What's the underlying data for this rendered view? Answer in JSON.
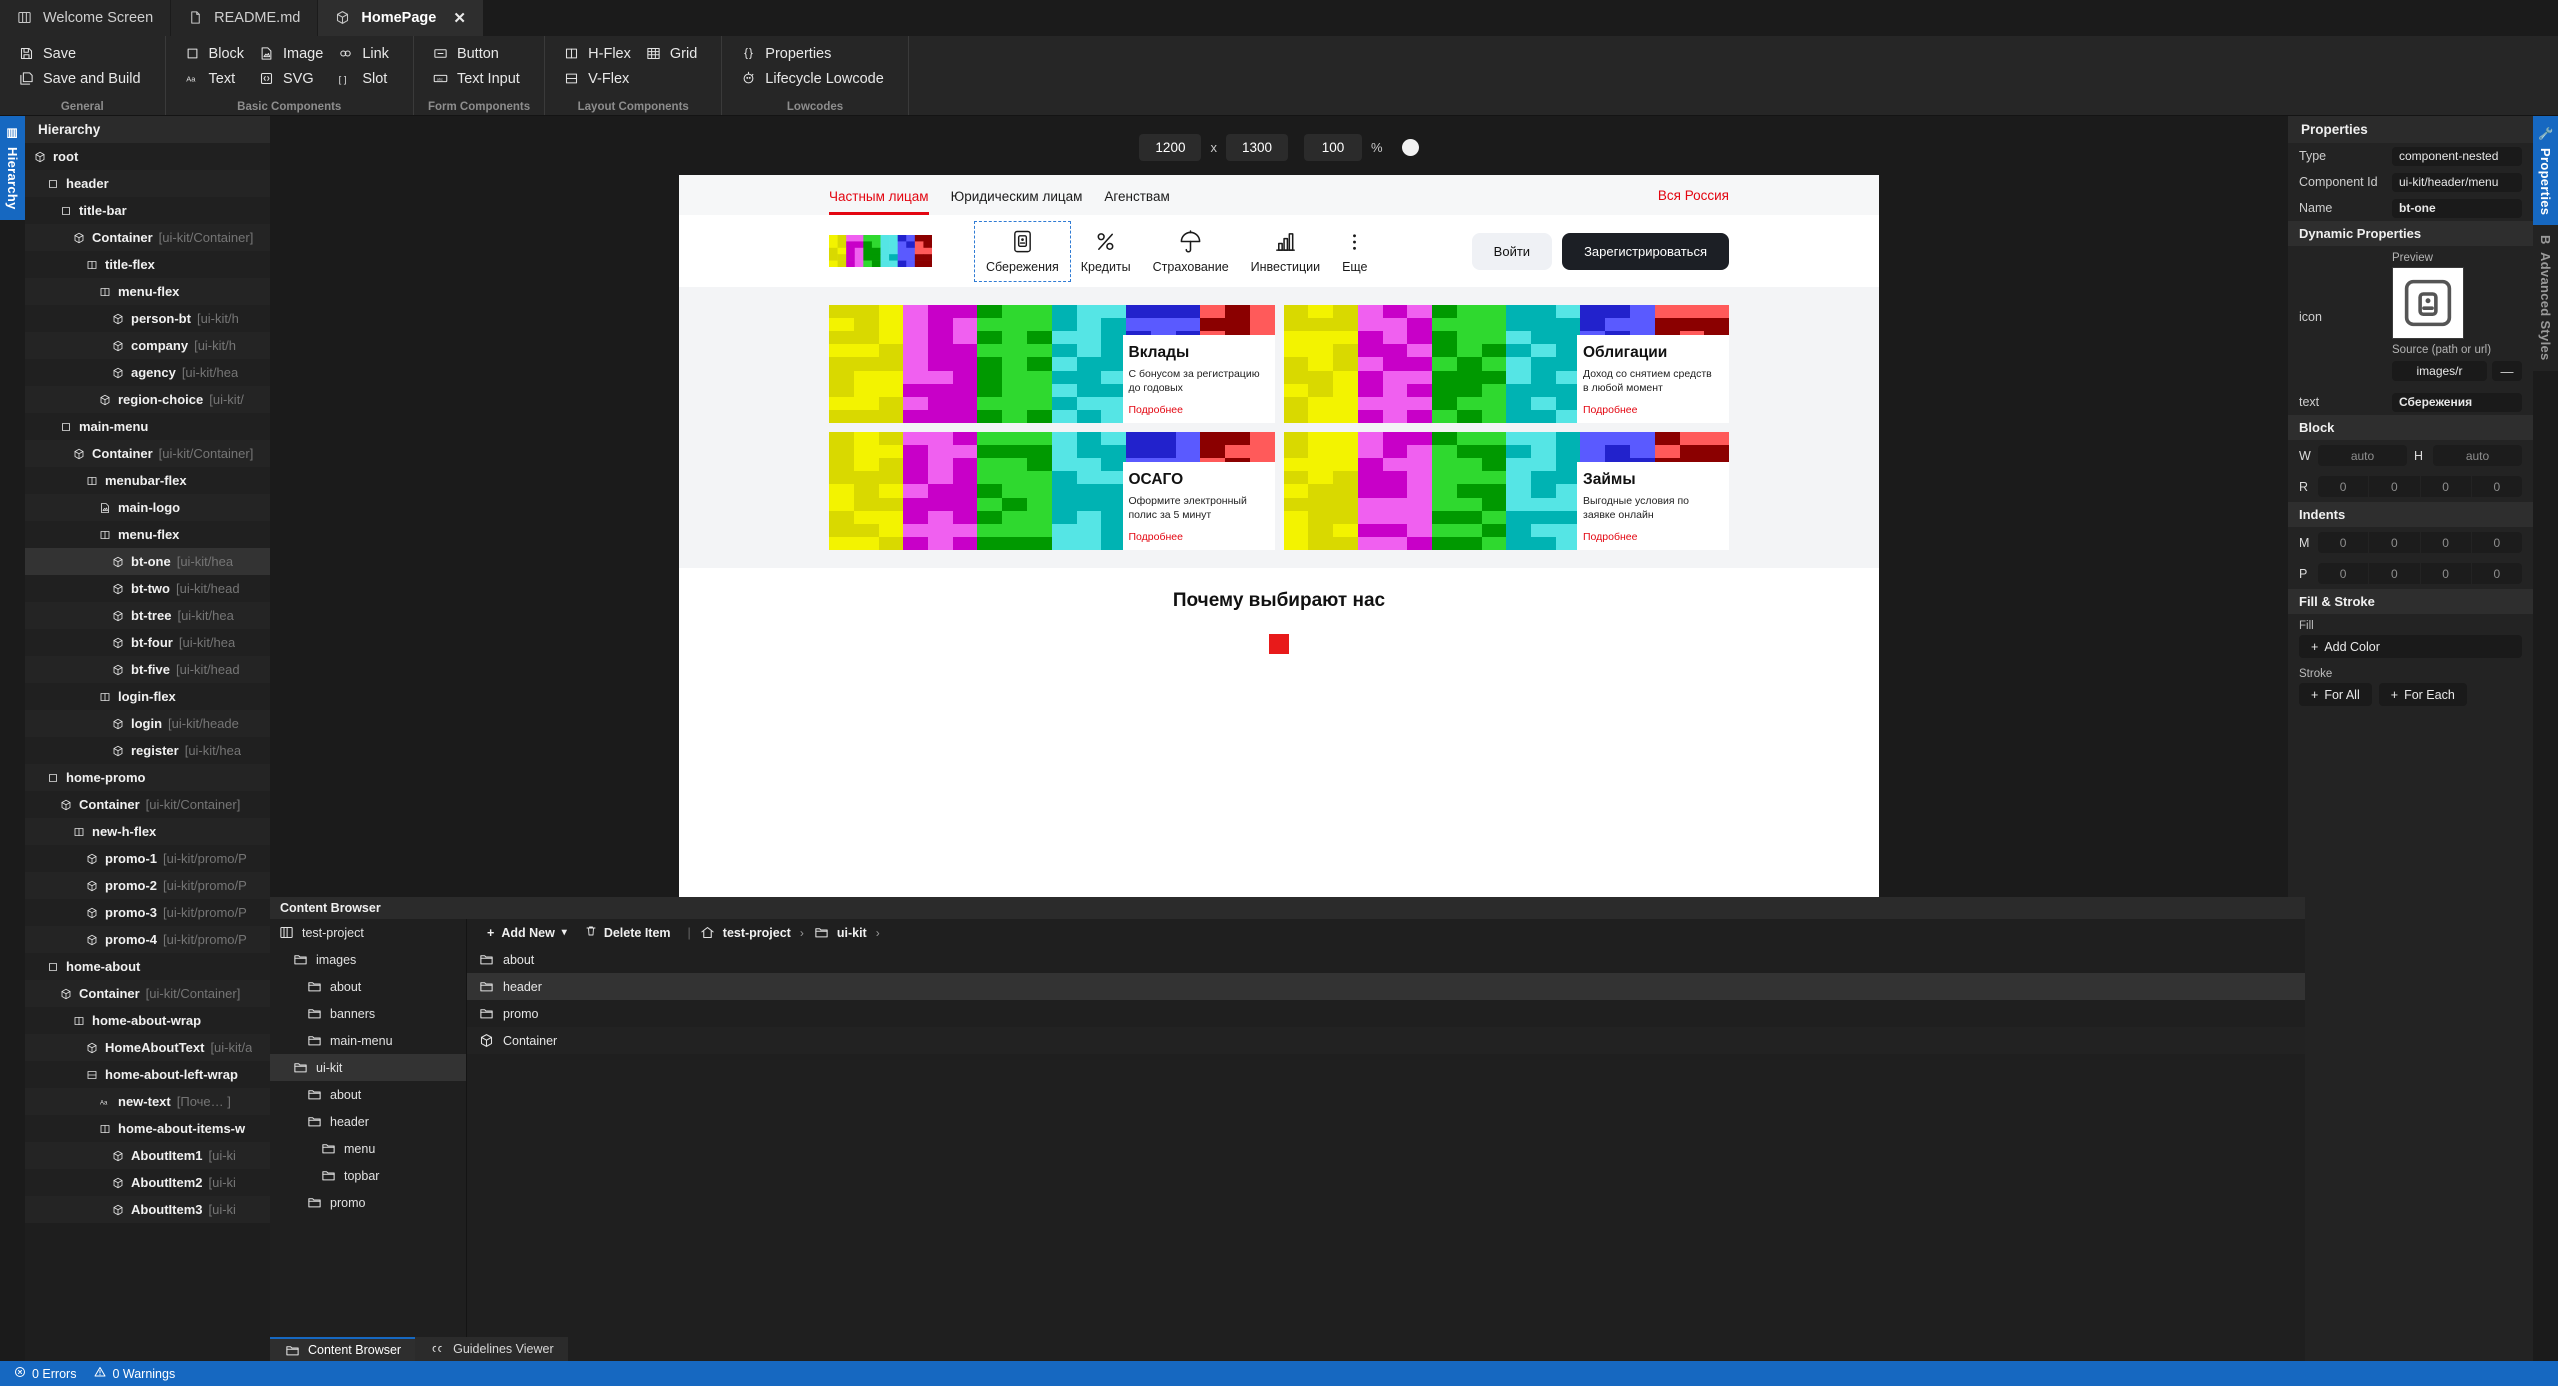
{
  "tabs": [
    {
      "label": "Welcome Screen",
      "icon": "window-icon",
      "active": false,
      "closable": false
    },
    {
      "label": "README.md",
      "icon": "file-icon",
      "active": false,
      "closable": false
    },
    {
      "label": "HomePage",
      "icon": "cube-icon",
      "active": true,
      "closable": true
    }
  ],
  "toolbar": {
    "groups": [
      {
        "label": "General",
        "columns": [
          {
            "items": [
              {
                "label": "Save",
                "icon": "save-icon"
              },
              {
                "label": "Save and Build",
                "icon": "save-build-icon"
              }
            ]
          }
        ]
      },
      {
        "label": "Basic Components",
        "columns": [
          {
            "items": [
              {
                "label": "Block",
                "icon": "square-icon"
              },
              {
                "label": "Text",
                "icon": "text-icon"
              }
            ]
          },
          {
            "items": [
              {
                "label": "Image",
                "icon": "image-icon"
              },
              {
                "label": "SVG",
                "icon": "svg-icon"
              }
            ]
          },
          {
            "items": [
              {
                "label": "Link",
                "icon": "link-icon"
              },
              {
                "label": "Slot",
                "icon": "slot-icon"
              }
            ]
          }
        ]
      },
      {
        "label": "Form Components",
        "columns": [
          {
            "items": [
              {
                "label": "Button",
                "icon": "button-icon"
              },
              {
                "label": "Text Input",
                "icon": "text-input-icon"
              }
            ]
          }
        ]
      },
      {
        "label": "Layout Components",
        "columns": [
          {
            "items": [
              {
                "label": "H-Flex",
                "icon": "hflex-icon"
              },
              {
                "label": "V-Flex",
                "icon": "vflex-icon"
              }
            ]
          },
          {
            "items": [
              {
                "label": "Grid",
                "icon": "grid-icon"
              }
            ]
          }
        ]
      },
      {
        "label": "Lowcodes",
        "columns": [
          {
            "items": [
              {
                "label": "Properties",
                "icon": "braces-icon"
              },
              {
                "label": "Lifecycle Lowcode",
                "icon": "lifecycle-icon"
              }
            ]
          }
        ]
      }
    ]
  },
  "rail": {
    "hierarchy_label": "Hierarchy",
    "properties_label": "Properties",
    "advanced_label": "Advanced Styles",
    "b_label": "B"
  },
  "hierarchy": {
    "title": "Hierarchy",
    "items": [
      {
        "name": "root",
        "path": "",
        "indent": 0,
        "icon": "cube-icon",
        "selected": false
      },
      {
        "name": "header",
        "path": "",
        "indent": 1,
        "icon": "square-icon",
        "selected": false
      },
      {
        "name": "title-bar",
        "path": "",
        "indent": 2,
        "icon": "square-icon",
        "selected": false
      },
      {
        "name": "Container",
        "path": "[ui-kit/Container]",
        "indent": 3,
        "icon": "cube-icon",
        "selected": false
      },
      {
        "name": "title-flex",
        "path": "",
        "indent": 4,
        "icon": "hflex-icon",
        "selected": false
      },
      {
        "name": "menu-flex",
        "path": "",
        "indent": 5,
        "icon": "hflex-icon",
        "selected": false
      },
      {
        "name": "person-bt",
        "path": "[ui-kit/h",
        "indent": 6,
        "icon": "cube-icon",
        "selected": false
      },
      {
        "name": "company",
        "path": "[ui-kit/h",
        "indent": 6,
        "icon": "cube-icon",
        "selected": false
      },
      {
        "name": "agency",
        "path": "[ui-kit/hea",
        "indent": 6,
        "icon": "cube-icon",
        "selected": false
      },
      {
        "name": "region-choice",
        "path": "[ui-kit/",
        "indent": 5,
        "icon": "cube-icon",
        "selected": false
      },
      {
        "name": "main-menu",
        "path": "",
        "indent": 2,
        "icon": "square-icon",
        "selected": false
      },
      {
        "name": "Container",
        "path": "[ui-kit/Container]",
        "indent": 3,
        "icon": "cube-icon",
        "selected": false
      },
      {
        "name": "menubar-flex",
        "path": "",
        "indent": 4,
        "icon": "hflex-icon",
        "selected": false
      },
      {
        "name": "main-logo",
        "path": "",
        "indent": 5,
        "icon": "image-icon",
        "selected": false
      },
      {
        "name": "menu-flex",
        "path": "",
        "indent": 5,
        "icon": "hflex-icon",
        "selected": false
      },
      {
        "name": "bt-one",
        "path": "[ui-kit/hea",
        "indent": 6,
        "icon": "cube-icon",
        "selected": true
      },
      {
        "name": "bt-two",
        "path": "[ui-kit/head",
        "indent": 6,
        "icon": "cube-icon",
        "selected": false
      },
      {
        "name": "bt-tree",
        "path": "[ui-kit/hea",
        "indent": 6,
        "icon": "cube-icon",
        "selected": false
      },
      {
        "name": "bt-four",
        "path": "[ui-kit/hea",
        "indent": 6,
        "icon": "cube-icon",
        "selected": false
      },
      {
        "name": "bt-five",
        "path": "[ui-kit/head",
        "indent": 6,
        "icon": "cube-icon",
        "selected": false
      },
      {
        "name": "login-flex",
        "path": "",
        "indent": 5,
        "icon": "hflex-icon",
        "selected": false
      },
      {
        "name": "login",
        "path": "[ui-kit/heade",
        "indent": 6,
        "icon": "cube-icon",
        "selected": false
      },
      {
        "name": "register",
        "path": "[ui-kit/hea",
        "indent": 6,
        "icon": "cube-icon",
        "selected": false
      },
      {
        "name": "home-promo",
        "path": "",
        "indent": 1,
        "icon": "square-icon",
        "selected": false
      },
      {
        "name": "Container",
        "path": "[ui-kit/Container]",
        "indent": 2,
        "icon": "cube-icon",
        "selected": false
      },
      {
        "name": "new-h-flex",
        "path": "",
        "indent": 3,
        "icon": "hflex-icon",
        "selected": false
      },
      {
        "name": "promo-1",
        "path": "[ui-kit/promo/P",
        "indent": 4,
        "icon": "cube-icon",
        "selected": false
      },
      {
        "name": "promo-2",
        "path": "[ui-kit/promo/P",
        "indent": 4,
        "icon": "cube-icon",
        "selected": false
      },
      {
        "name": "promo-3",
        "path": "[ui-kit/promo/P",
        "indent": 4,
        "icon": "cube-icon",
        "selected": false
      },
      {
        "name": "promo-4",
        "path": "[ui-kit/promo/P",
        "indent": 4,
        "icon": "cube-icon",
        "selected": false
      },
      {
        "name": "home-about",
        "path": "",
        "indent": 1,
        "icon": "square-icon",
        "selected": false
      },
      {
        "name": "Container",
        "path": "[ui-kit/Container]",
        "indent": 2,
        "icon": "cube-icon",
        "selected": false
      },
      {
        "name": "home-about-wrap",
        "path": "",
        "indent": 3,
        "icon": "hflex-icon",
        "selected": false
      },
      {
        "name": "HomeAboutText",
        "path": "[ui-kit/a",
        "indent": 4,
        "icon": "cube-icon",
        "selected": false
      },
      {
        "name": "home-about-left-wrap",
        "path": "",
        "indent": 4,
        "icon": "vflex-icon",
        "selected": false
      },
      {
        "name": "new-text",
        "path": "[Поче… ]",
        "indent": 5,
        "icon": "text-icon",
        "selected": false
      },
      {
        "name": "home-about-items-w",
        "path": "",
        "indent": 5,
        "icon": "hflex-icon",
        "selected": false
      },
      {
        "name": "AboutItem1",
        "path": "[ui-ki",
        "indent": 6,
        "icon": "cube-icon",
        "selected": false
      },
      {
        "name": "AboutItem2",
        "path": "[ui-ki",
        "indent": 6,
        "icon": "cube-icon",
        "selected": false
      },
      {
        "name": "AboutItem3",
        "path": "[ui-ki",
        "indent": 6,
        "icon": "cube-icon",
        "selected": false
      }
    ]
  },
  "canvas": {
    "width": "1200",
    "height": "1300",
    "x_separator": "x",
    "zoom": "100",
    "percent": "%"
  },
  "site": {
    "topnav": [
      {
        "label": "Частным лицам",
        "active": true
      },
      {
        "label": "Юридическим лицам",
        "active": false
      },
      {
        "label": "Агенствам",
        "active": false
      }
    ],
    "region": "Вся Россия",
    "menu": [
      {
        "label": "Сбережения",
        "icon": "savings-icon",
        "selected": true
      },
      {
        "label": "Кредиты",
        "icon": "percent-icon",
        "selected": false
      },
      {
        "label": "Страхование",
        "icon": "umbrella-icon",
        "selected": false
      },
      {
        "label": "Инвестиции",
        "icon": "chart-icon",
        "selected": false
      },
      {
        "label": "Еще",
        "icon": "dots-icon",
        "selected": false
      }
    ],
    "login_label": "Войти",
    "register_label": "Зарегистрироваться",
    "promos": [
      {
        "title": "Вклады",
        "desc": "С бонусом за регистрацию до годовых",
        "link": "Подробнее"
      },
      {
        "title": "Облигации",
        "desc": "Доход со снятием средств в любой момент",
        "link": "Подробнее"
      },
      {
        "title": "ОСАГО",
        "desc": "Оформите электронный полис за 5 минут",
        "link": "Подробнее"
      },
      {
        "title": "Займы",
        "desc": "Выгодные условия по заявке онлайн",
        "link": "Подробнее"
      }
    ],
    "about_title": "Почему выбирают нас",
    "accent_red": "#e30611",
    "dark_button": "#1c1f25"
  },
  "properties": {
    "title": "Properties",
    "type_label": "Type",
    "type_value": "component-nested",
    "component_id_label": "Component Id",
    "component_id_value": "ui-kit/header/menu",
    "name_label": "Name",
    "name_value": "bt-one",
    "dynamic_title": "Dynamic Properties",
    "icon_label": "icon",
    "preview_label": "Preview",
    "source_label": "Source (path or url)",
    "source_value": "images/r",
    "source_clear": "—",
    "text_label": "text",
    "text_value": "Сбережения",
    "block_title": "Block",
    "w_label": "W",
    "w_value": "auto",
    "h_label": "H",
    "h_value": "auto",
    "r_label": "R",
    "r_values": [
      "0",
      "0",
      "0",
      "0"
    ],
    "indents_title": "Indents",
    "m_label": "M",
    "m_values": [
      "0",
      "0",
      "0",
      "0"
    ],
    "p_label": "P",
    "p_values": [
      "0",
      "0",
      "0",
      "0"
    ],
    "fill_stroke_title": "Fill & Stroke",
    "fill_label": "Fill",
    "add_color_label": "Add Color",
    "stroke_label": "Stroke",
    "for_all_label": "For All",
    "for_each_label": "For Each"
  },
  "content_browser": {
    "title": "Content Browser",
    "tree": [
      {
        "label": "test-project",
        "indent": 0,
        "icon": "project-icon",
        "selected": false
      },
      {
        "label": "images",
        "indent": 1,
        "icon": "folder-icon",
        "selected": false
      },
      {
        "label": "about",
        "indent": 2,
        "icon": "folder-icon",
        "selected": false
      },
      {
        "label": "banners",
        "indent": 2,
        "icon": "folder-icon",
        "selected": false
      },
      {
        "label": "main-menu",
        "indent": 2,
        "icon": "folder-icon",
        "selected": false
      },
      {
        "label": "ui-kit",
        "indent": 1,
        "icon": "folder-icon",
        "selected": true
      },
      {
        "label": "about",
        "indent": 2,
        "icon": "folder-icon",
        "selected": false
      },
      {
        "label": "header",
        "indent": 2,
        "icon": "folder-icon",
        "selected": false
      },
      {
        "label": "menu",
        "indent": 3,
        "icon": "folder-icon",
        "selected": false
      },
      {
        "label": "topbar",
        "indent": 3,
        "icon": "folder-icon",
        "selected": false
      },
      {
        "label": "promo",
        "indent": 2,
        "icon": "folder-icon",
        "selected": false
      }
    ],
    "add_new_label": "Add New",
    "delete_item_label": "Delete Item",
    "breadcrumbs": [
      {
        "label": "test-project",
        "icon": "home-icon"
      },
      {
        "label": "ui-kit",
        "icon": "folder-icon"
      }
    ],
    "items": [
      {
        "label": "about",
        "icon": "folder-icon",
        "selected": false
      },
      {
        "label": "header",
        "icon": "folder-icon",
        "selected": true
      },
      {
        "label": "promo",
        "icon": "folder-icon",
        "selected": false
      },
      {
        "label": "Container",
        "icon": "cube-icon",
        "selected": false
      }
    ]
  },
  "bottom_tabs": [
    {
      "label": "Content Browser",
      "icon": "folder-icon",
      "active": true
    },
    {
      "label": "Guidelines Viewer",
      "icon": "quote-icon",
      "active": false
    }
  ],
  "status": {
    "errors": "0 Errors",
    "warnings": "0 Warnings",
    "bg": "#1668c1"
  }
}
